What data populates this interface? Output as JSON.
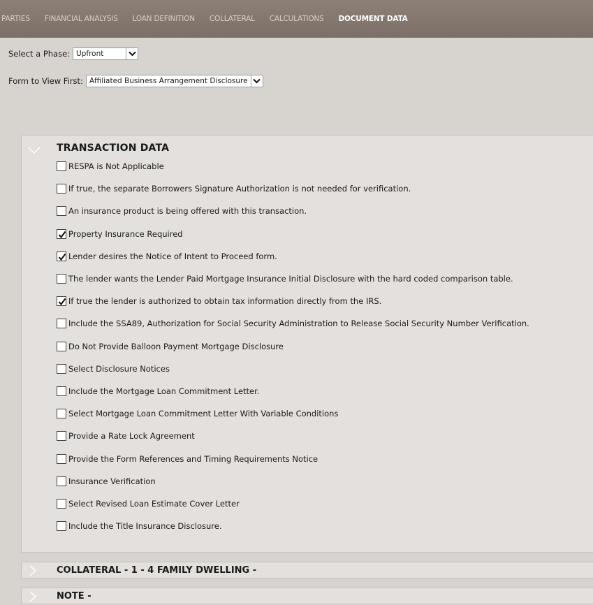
{
  "nav": {
    "tabs": [
      {
        "label": "PARTIES"
      },
      {
        "label": "FINANCIAL ANALYSIS"
      },
      {
        "label": "LOAN DEFINITION"
      },
      {
        "label": "COLLATERAL"
      },
      {
        "label": "CALCULATIONS"
      },
      {
        "label": "DOCUMENT DATA"
      }
    ],
    "active": "DOCUMENT DATA"
  },
  "phase": {
    "label": "Select a Phase:",
    "value": "Upfront"
  },
  "form_first": {
    "label": "Form to View First:",
    "value": "Affiliated Business Arrangement Disclosure"
  },
  "transaction": {
    "title": "TRANSACTION DATA",
    "items": [
      {
        "label": "RESPA is Not Applicable",
        "checked": false
      },
      {
        "label": "If true, the separate Borrowers Signature Authorization is not needed for verification.",
        "checked": false
      },
      {
        "label": "An insurance product is being offered with this transaction.",
        "checked": false
      },
      {
        "label": "Property Insurance Required",
        "checked": true
      },
      {
        "label": "Lender desires the Notice of Intent to Proceed form.",
        "checked": true
      },
      {
        "label": "The lender wants the Lender Paid Mortgage Insurance Initial Disclosure with the hard coded comparison table.",
        "checked": false
      },
      {
        "label": "If true the lender is authorized to obtain tax information directly from the IRS.",
        "checked": true
      },
      {
        "label": "Include the SSA89, Authorization for Social Security Administration to Release Social Security Number Verification.",
        "checked": false
      },
      {
        "label": "Do Not Provide Balloon Payment Mortgage Disclosure",
        "checked": false
      },
      {
        "label": "Select Disclosure Notices",
        "checked": false
      },
      {
        "label": "Include the Mortgage Loan Commitment Letter.",
        "checked": false
      },
      {
        "label": "Select Mortgage Loan Commitment Letter With Variable Conditions",
        "checked": false
      },
      {
        "label": "Provide a Rate Lock Agreement",
        "checked": false
      },
      {
        "label": "Provide the Form References and Timing Requirements Notice",
        "checked": false
      },
      {
        "label": "Insurance Verification",
        "checked": false
      },
      {
        "label": "Select Revised Loan Estimate Cover Letter",
        "checked": false
      },
      {
        "label": "Include the Title Insurance Disclosure.",
        "checked": false
      }
    ]
  },
  "sections": [
    {
      "title": "COLLATERAL - 1 - 4 FAMILY DWELLING -"
    },
    {
      "title": "NOTE -"
    }
  ]
}
